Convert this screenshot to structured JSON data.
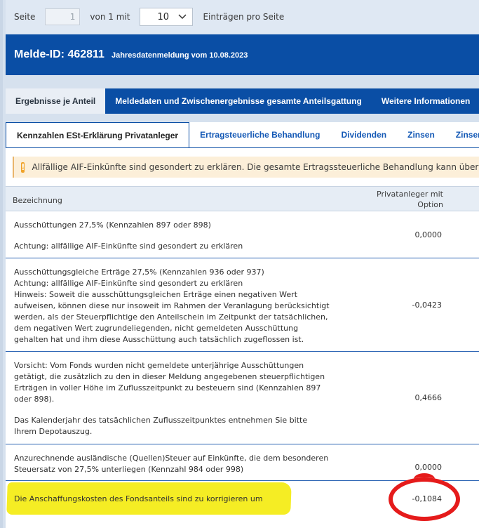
{
  "pager": {
    "label_page": "Seite",
    "page_value": "1",
    "label_of": "von 1 mit",
    "per_page_value": "10",
    "label_entries": "Einträgen pro Seite"
  },
  "header": {
    "melde_id": "Melde-ID: 462811",
    "subtitle": "Jahresdatenmeldung vom 10.08.2023"
  },
  "main_tabs": [
    {
      "label": "Ergebnisse je Anteil"
    },
    {
      "label": "Meldedaten und Zwischenergebnisse gesamte Anteilsgattung"
    },
    {
      "label": "Weitere Informationen"
    }
  ],
  "sub_tabs": [
    {
      "label": "Kennzahlen ESt-Erklärung Privatanleger"
    },
    {
      "label": "Ertragsteuerliche Behandlung"
    },
    {
      "label": "Dividenden"
    },
    {
      "label": "Zinsen"
    },
    {
      "label": "Zinsen"
    }
  ],
  "alert": {
    "icon": "warning-icon",
    "text": "Allfällige AIF-Einkünfte sind gesondert zu erklären. Die gesamte Ertragssteuerliche Behandlung kann über den entsp"
  },
  "table": {
    "col_name": "Bezeichnung",
    "col_value_line1": "Privatanleger mit",
    "col_value_line2": "Option",
    "rows": [
      {
        "lines": [
          "Ausschüttungen 27,5% (Kennzahlen 897 oder 898)",
          "",
          "Achtung: allfällige AIF-Einkünfte sind gesondert zu erklären"
        ],
        "value": "0,0000"
      },
      {
        "lines": [
          "Ausschüttungsgleiche Erträge 27,5% (Kennzahlen 936 oder 937)",
          "Achtung: allfällige AIF-Einkünfte sind gesondert zu erklären",
          "Hinweis: Soweit die ausschüttungsgleichen Erträge einen negativen Wert",
          "aufweisen, können diese nur insoweit im Rahmen der Veranlagung berücksichtigt",
          "werden, als der Steuerpflichtige den Anteilschein im Zeitpunkt der tatsächlichen,",
          "dem negativen Wert zugrundeliegenden, nicht gemeldeten Ausschüttung",
          "gehalten hat und ihm diese Ausschüttung auch tatsächlich zugeflossen ist."
        ],
        "value": "-0,0423"
      },
      {
        "lines": [
          "Vorsicht: Vom Fonds wurden nicht gemeldete unterjährige Ausschüttungen",
          "getätigt, die zusätzlich zu den in dieser Meldung angegebenen steuerpflichtigen",
          "Erträgen in voller Höhe im Zuflusszeitpunkt zu besteuern sind (Kennzahlen 897",
          "oder 898).",
          "",
          "Das Kalenderjahr des tatsächlichen Zuflusszeitpunktes entnehmen Sie bitte",
          "Ihrem Depotauszug."
        ],
        "value": "0,4666"
      },
      {
        "lines": [
          "Anzurechnende ausländische (Quellen)Steuer auf Einkünfte, die dem besonderen",
          "Steuersatz von 27,5% unterliegen (Kennzahl 984 oder 998)"
        ],
        "value": "0,0000"
      },
      {
        "lines": [
          "Die Anschaffungskosten des Fondsanteils sind zu korrigieren um"
        ],
        "value": "-0,1084"
      }
    ]
  },
  "annotations": {
    "highlight_color": "#f5ed24",
    "circle_color": "#e51b1b"
  }
}
